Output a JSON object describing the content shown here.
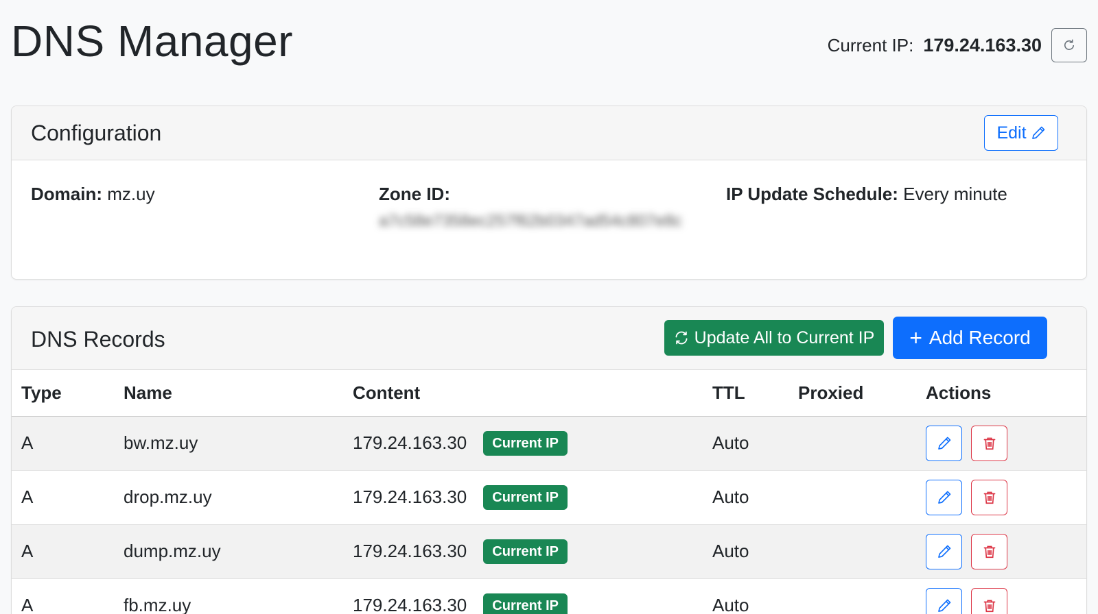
{
  "header": {
    "title": "DNS Manager",
    "current_ip_label": "Current IP:",
    "current_ip_value": "179.24.163.30",
    "refresh_icon": "refresh-icon"
  },
  "config": {
    "title": "Configuration",
    "edit_label": "Edit",
    "edit_icon": "pencil-icon",
    "domain_label": "Domain:",
    "domain_value": "mz.uy",
    "zone_label": "Zone ID:",
    "zone_value": "a7c58e7358ec257f62b0347ad54c807e8c",
    "schedule_label": "IP Update Schedule:",
    "schedule_value": "Every minute"
  },
  "records": {
    "title": "DNS Records",
    "update_all_label": "Update All to Current IP",
    "add_record_label": "Add Record",
    "add_icon": "plus-icon",
    "columns": [
      "Type",
      "Name",
      "Content",
      "TTL",
      "Proxied",
      "Actions"
    ],
    "rows": [
      {
        "type": "A",
        "name": "bw.mz.uy",
        "content": "179.24.163.30",
        "badge": "Current IP",
        "ttl": "Auto",
        "proxied": ""
      },
      {
        "type": "A",
        "name": "drop.mz.uy",
        "content": "179.24.163.30",
        "badge": "Current IP",
        "ttl": "Auto",
        "proxied": ""
      },
      {
        "type": "A",
        "name": "dump.mz.uy",
        "content": "179.24.163.30",
        "badge": "Current IP",
        "ttl": "Auto",
        "proxied": ""
      },
      {
        "type": "A",
        "name": "fb.mz.uy",
        "content": "179.24.163.30",
        "badge": "Current IP",
        "ttl": "Auto",
        "proxied": ""
      }
    ]
  },
  "colors": {
    "primary": "#0d6efd",
    "success": "#198754",
    "danger": "#dc3545",
    "background": "#f8f9fa"
  }
}
